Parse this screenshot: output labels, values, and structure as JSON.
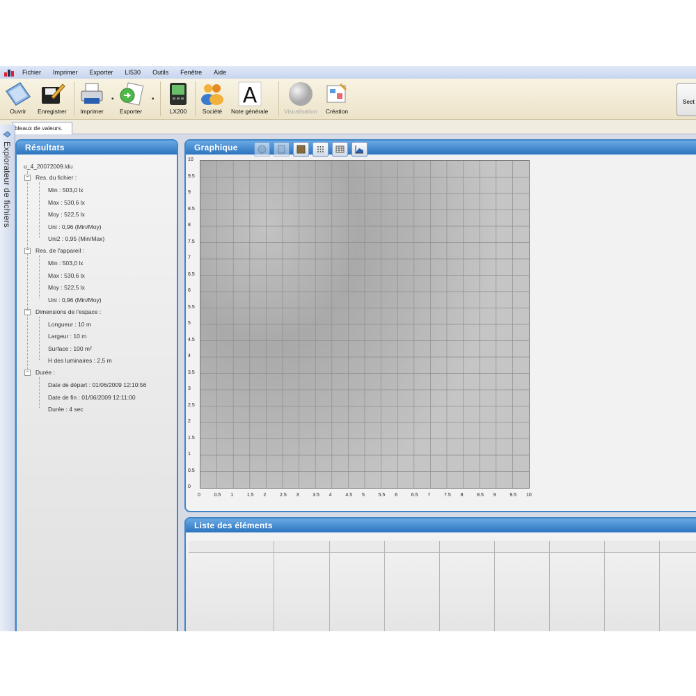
{
  "menu": {
    "items": [
      "Fichier",
      "Imprimer",
      "Exporter",
      "LI530",
      "Outils",
      "Fenêtre",
      "Aide"
    ]
  },
  "toolbar": {
    "buttons": [
      {
        "label": "Ouvrir",
        "icon": "folder-icon"
      },
      {
        "label": "Enregistrer",
        "icon": "save-icon"
      },
      {
        "label": "Imprimer",
        "icon": "printer-icon"
      },
      {
        "label": "Exporter",
        "icon": "export-icon"
      },
      {
        "label": "LX200",
        "icon": "device-icon"
      },
      {
        "label": "Société",
        "icon": "company-icon"
      },
      {
        "label": "Note générale",
        "icon": "note-icon"
      },
      {
        "label": "Visualisation",
        "icon": "sphere-icon",
        "disabled": true
      },
      {
        "label": "Création",
        "icon": "creation-icon"
      }
    ],
    "right_button": "Sect"
  },
  "tabs": {
    "active": "bleaux de valeurs.",
    "close": "x"
  },
  "explorer": {
    "label": "Explorateur de fichiers"
  },
  "results": {
    "title": "Résultats",
    "file": "u_4_20072009.ldu",
    "groups": [
      {
        "label": "Res. du fichier :",
        "items": [
          "Min : 503,0 lx",
          "Max : 530,6 lx",
          "Moy : 522,5 lx",
          "Uni : 0,96 (Min/Moy)",
          "Uni2 : 0,95 (Min/Max)"
        ]
      },
      {
        "label": "Res. de l'appareil :",
        "items": [
          "Min : 503,0 lx",
          "Max : 530,6 lx",
          "Moy : 522,5 lx",
          "Uni : 0,96 (Min/Moy)"
        ]
      },
      {
        "label": "Dimensions de l'espace :",
        "items": [
          "Longueur : 10 m",
          "Largeur : 10 m",
          "Surface : 100 m²",
          "H des luminaires : 2,5 m"
        ]
      },
      {
        "label": "Durée :",
        "items": [
          "Date de départ : 01/06/2009 12:10:56",
          "Date de fin : 01/06/2009 12:11:00",
          "Durée : 4 sec"
        ]
      }
    ]
  },
  "graph": {
    "title": "Graphique",
    "x_ticks": [
      "0",
      "0.5",
      "1",
      "1.5",
      "2",
      "2.5",
      "3",
      "3.5",
      "4",
      "4.5",
      "5",
      "5.5",
      "6",
      "6.5",
      "7",
      "7.5",
      "8",
      "8.5",
      "9",
      "9.5",
      "10"
    ],
    "y_ticks": [
      "10",
      "9.5",
      "9",
      "8.5",
      "8",
      "7.5",
      "7",
      "6.5",
      "6",
      "5.5",
      "5",
      "4.5",
      "4",
      "3.5",
      "3",
      "2.5",
      "2",
      "1.5",
      "1",
      "0.5",
      "0"
    ],
    "tools": [
      {
        "icon": "sphere-tool-icon",
        "disabled": true
      },
      {
        "icon": "page-tool-icon",
        "disabled": true
      },
      {
        "icon": "texture-tool-icon",
        "disabled": false
      },
      {
        "icon": "grid-dots-tool-icon",
        "disabled": false
      },
      {
        "icon": "table-tool-icon",
        "disabled": false
      },
      {
        "icon": "chart-3d-tool-icon",
        "disabled": false
      }
    ]
  },
  "elements": {
    "title": "Liste des éléments"
  },
  "colors": {
    "panel_header": "#2c74bf",
    "panel_border": "#3e86c8",
    "toolbar_bg": "#f4eed9",
    "plot_fill": "#aaaaaa"
  }
}
